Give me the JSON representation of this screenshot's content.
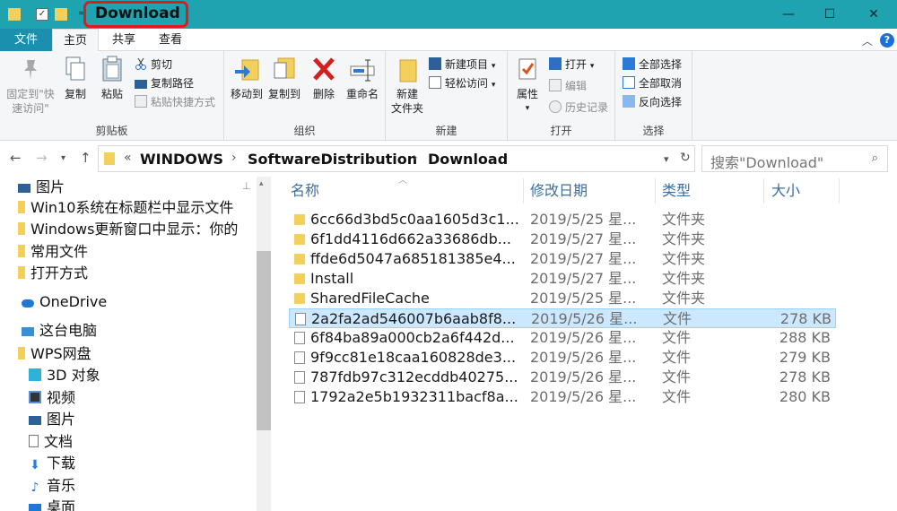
{
  "window": {
    "title": "Download"
  },
  "tabs": {
    "file": "文件",
    "home": "主页",
    "share": "共享",
    "view": "查看"
  },
  "ribbon": {
    "clipboard": {
      "title": "剪贴板",
      "pin": "固定到\"快速访问\"",
      "copy": "复制",
      "paste": "粘贴",
      "cut": "剪切",
      "copy_path": "复制路径",
      "paste_shortcut": "粘贴快捷方式"
    },
    "organize": {
      "title": "组织",
      "move_to": "移动到",
      "copy_to": "复制到",
      "delete": "删除",
      "rename": "重命名"
    },
    "new": {
      "title": "新建",
      "new_folder": "新建\n文件夹",
      "new_item": "新建项目",
      "easy_access": "轻松访问"
    },
    "open": {
      "title": "打开",
      "properties": "属性",
      "open": "打开",
      "edit": "编辑",
      "history": "历史记录"
    },
    "select": {
      "title": "选择",
      "select_all": "全部选择",
      "select_none": "全部取消",
      "invert": "反向选择"
    }
  },
  "address": {
    "prefix": "«",
    "crumbs": [
      "WINDOWS",
      "SoftwareDistribution",
      "Download"
    ],
    "search_placeholder": "搜索\"Download\""
  },
  "nav": {
    "items": [
      {
        "label": "图片",
        "icon": "pictures-icon"
      },
      {
        "label": "Win10系统在标题栏中显示文件",
        "icon": "folder-icon"
      },
      {
        "label": "Windows更新窗口中显示：你的",
        "icon": "folder-icon"
      },
      {
        "label": "常用文件",
        "icon": "folder-icon"
      },
      {
        "label": "打开方式",
        "icon": "folder-icon"
      },
      {
        "label": "OneDrive",
        "icon": "cloud-icon"
      },
      {
        "label": "这台电脑",
        "icon": "computer-icon"
      },
      {
        "label": "WPS网盘",
        "icon": "folder-icon"
      },
      {
        "label": "3D 对象",
        "icon": "cube-icon"
      },
      {
        "label": "视频",
        "icon": "video-icon"
      },
      {
        "label": "图片",
        "icon": "pictures-icon"
      },
      {
        "label": "文档",
        "icon": "document-icon"
      },
      {
        "label": "下载",
        "icon": "download-icon"
      },
      {
        "label": "音乐",
        "icon": "music-icon"
      },
      {
        "label": "桌面",
        "icon": "desktop-icon"
      }
    ]
  },
  "columns": {
    "name": "名称",
    "date": "修改日期",
    "type": "类型",
    "size": "大小"
  },
  "files": [
    {
      "name": "6cc66d3bd5c0aa1605d3c1...",
      "date": "2019/5/25 星...",
      "type": "文件夹",
      "size": "",
      "kind": "folder"
    },
    {
      "name": "6f1dd4116d662a33686db...",
      "date": "2019/5/27 星...",
      "type": "文件夹",
      "size": "",
      "kind": "folder"
    },
    {
      "name": "ffde6d5047a685181385e4...",
      "date": "2019/5/27 星...",
      "type": "文件夹",
      "size": "",
      "kind": "folder"
    },
    {
      "name": "Install",
      "date": "2019/5/27 星...",
      "type": "文件夹",
      "size": "",
      "kind": "folder"
    },
    {
      "name": "SharedFileCache",
      "date": "2019/5/25 星...",
      "type": "文件夹",
      "size": "",
      "kind": "folder"
    },
    {
      "name": "2a2fa2ad546007b6aab8f8...",
      "date": "2019/5/26 星...",
      "type": "文件",
      "size": "278 KB",
      "kind": "file"
    },
    {
      "name": "6f84ba89a000cb2a6f442d...",
      "date": "2019/5/26 星...",
      "type": "文件",
      "size": "288 KB",
      "kind": "file"
    },
    {
      "name": "9f9cc81e18caa160828de3...",
      "date": "2019/5/26 星...",
      "type": "文件",
      "size": "279 KB",
      "kind": "file"
    },
    {
      "name": "787fdb97c312ecddb40275...",
      "date": "2019/5/26 星...",
      "type": "文件",
      "size": "278 KB",
      "kind": "file"
    },
    {
      "name": "1792a2e5b1932311bacf8a...",
      "date": "2019/5/26 星...",
      "type": "文件",
      "size": "280 KB",
      "kind": "file"
    }
  ]
}
